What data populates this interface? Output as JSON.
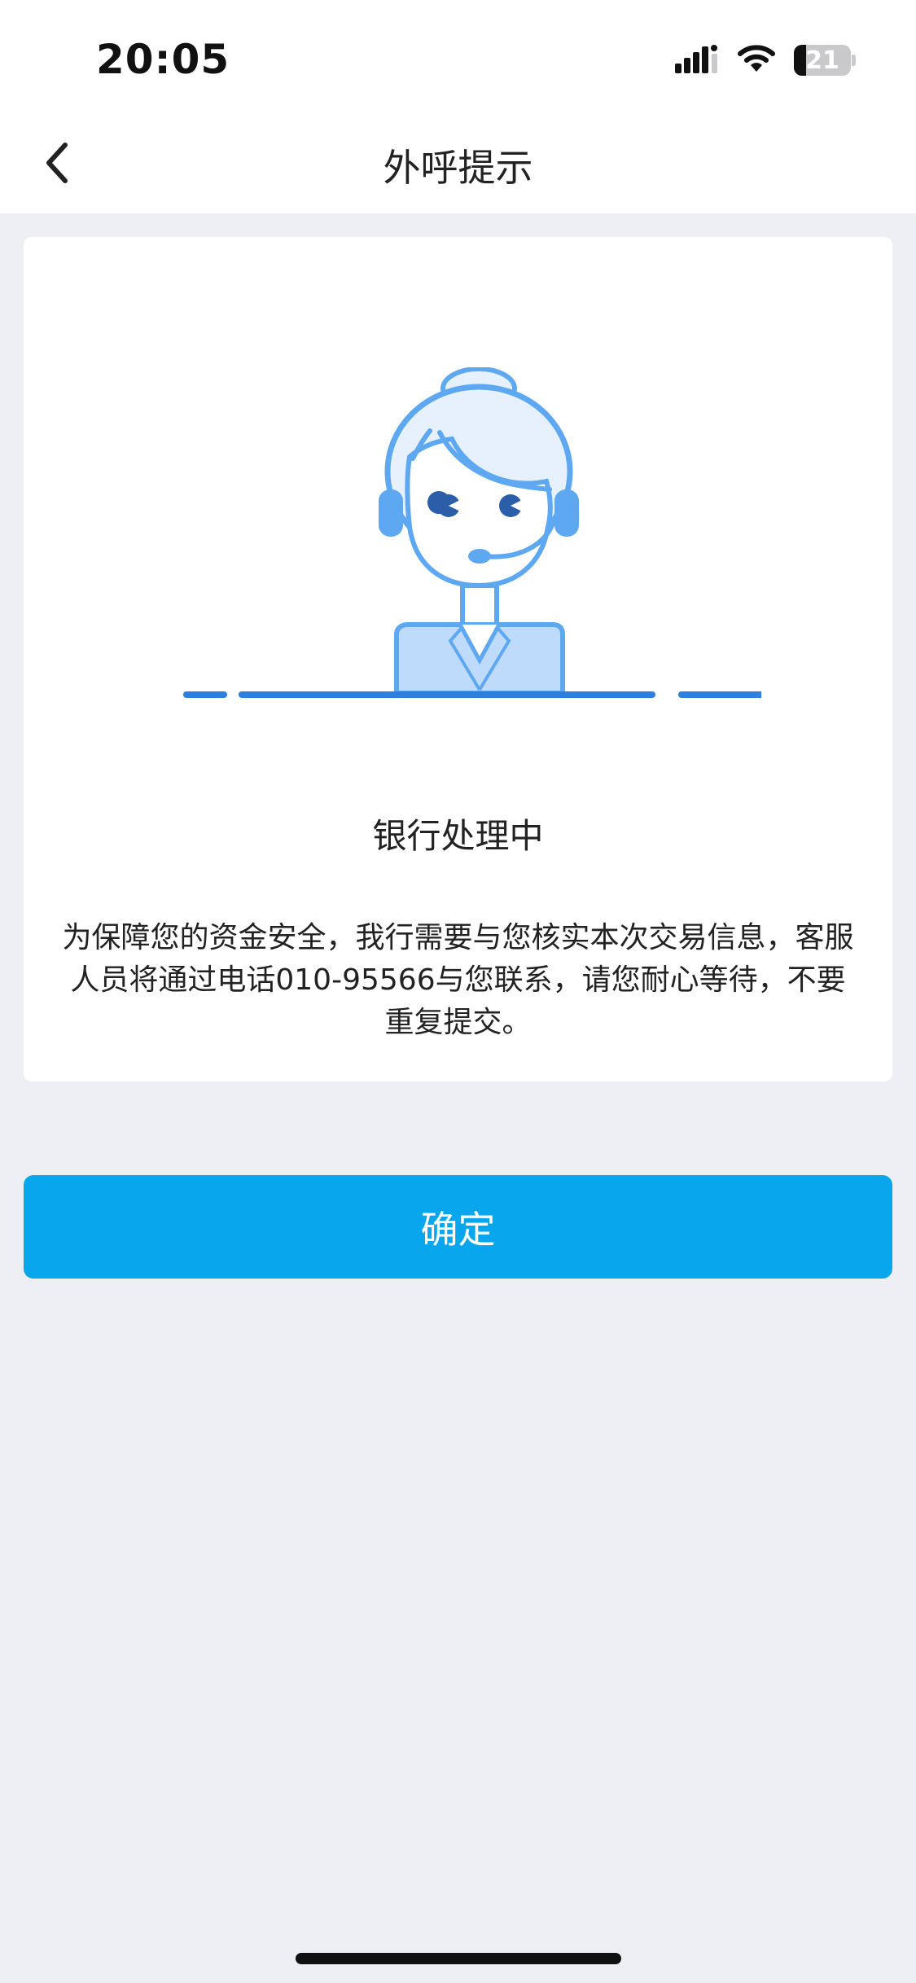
{
  "status_bar": {
    "time": "20:05",
    "battery_level": "21",
    "battery_fraction": 0.21,
    "icons": [
      "cellular-signal-icon",
      "wifi-icon",
      "battery-icon"
    ]
  },
  "nav": {
    "title": "外呼提示",
    "back_icon": "chevron-left-icon"
  },
  "card": {
    "illustration": "customer-service-agent-headset",
    "title": "银行处理中",
    "message": "为保障您的资金安全，我行需要与您核实本次交易信息，客服人员将通过电话010-95566与您联系，请您耐心等待，不要重复提交。"
  },
  "actions": {
    "confirm_label": "确定"
  },
  "colors": {
    "accent": "#08a6ec",
    "illustration_blue": "#5ea8f2",
    "illustration_light": "#e6f1fd",
    "page_background": "#eeeff4"
  }
}
